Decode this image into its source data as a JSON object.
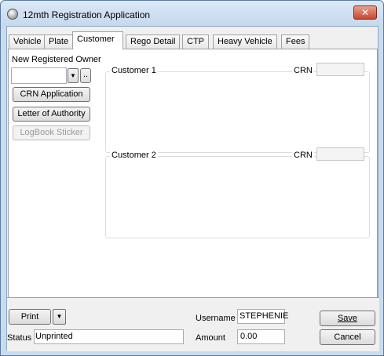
{
  "window": {
    "title": "12mth Registration Application",
    "close_glyph": "✕"
  },
  "tabs": [
    {
      "label": "Vehicle"
    },
    {
      "label": "Plate"
    },
    {
      "label": "Customer"
    },
    {
      "label": "Rego Detail"
    },
    {
      "label": "CTP"
    },
    {
      "label": "Heavy Vehicle"
    },
    {
      "label": "Fees"
    }
  ],
  "customer": {
    "new_owner_label": "New Registered Owner",
    "owner_value": "",
    "ellipsis_label": "..",
    "crn_application": "CRN Application",
    "letter_of_authority": "Letter of Authority",
    "logbook_sticker": "LogBook Sticker",
    "customer1_title": "Customer 1",
    "customer2_title": "Customer 2",
    "crn_label": "CRN",
    "crn1_value": "",
    "crn2_value": ""
  },
  "footer": {
    "print_label": "Print",
    "status_label": "Status",
    "status_value": "Unprinted",
    "username_label": "Username",
    "username_value": "STEPHENIE",
    "amount_label": "Amount",
    "amount_value": "0.00",
    "save_label": "Save",
    "cancel_label": "Cancel"
  },
  "colors": {
    "window_frame": "#c9dbee",
    "close_red": "#c7472e"
  }
}
